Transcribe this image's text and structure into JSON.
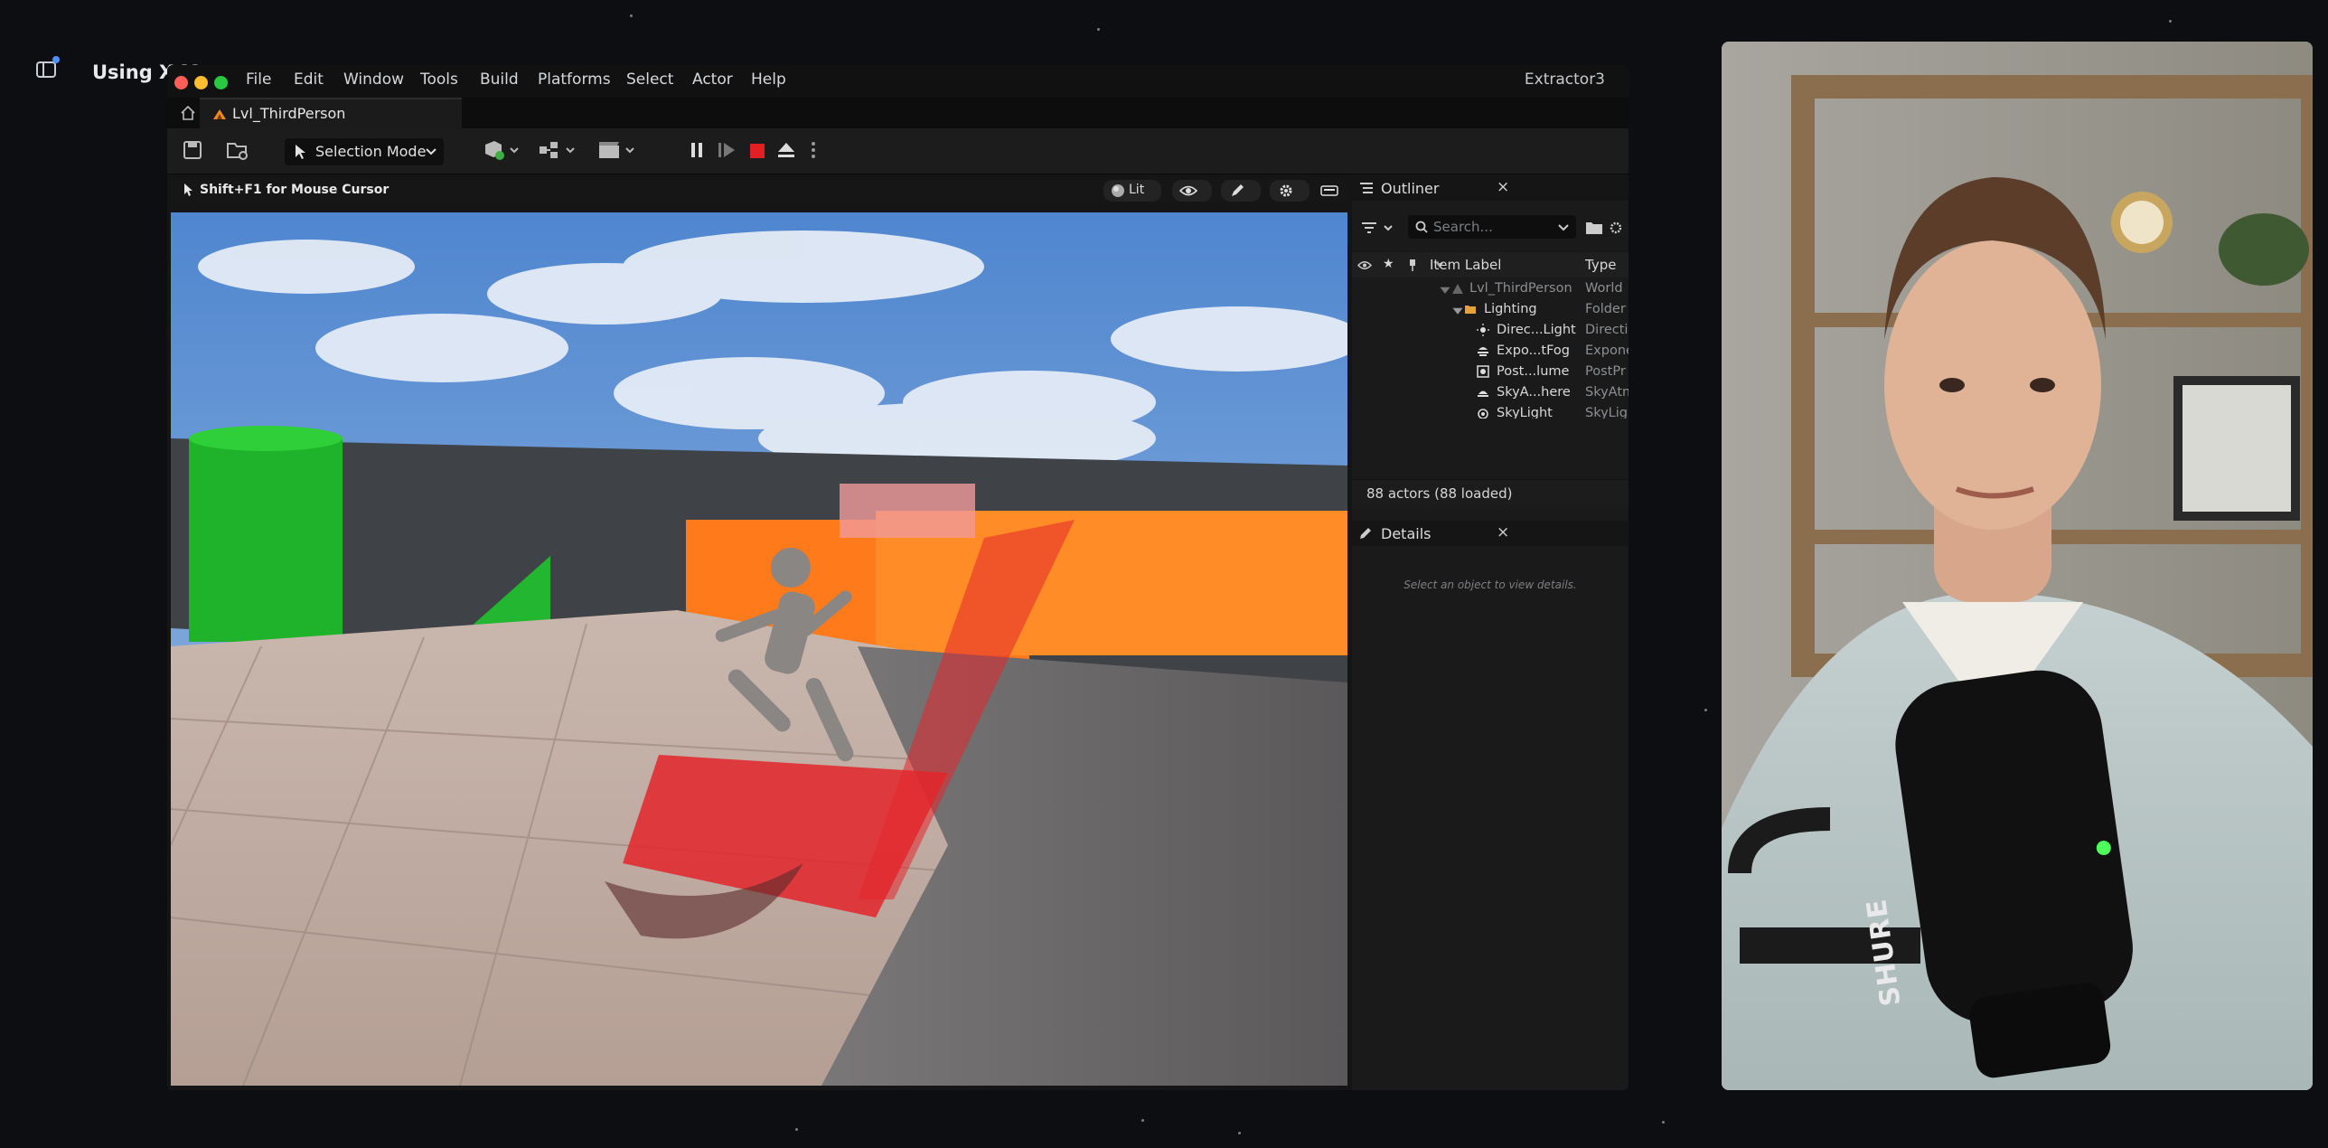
{
  "background": {
    "color": "#0d0e12"
  },
  "browser": {
    "doc_title": "Using X M"
  },
  "app": {
    "menu": [
      "File",
      "Edit",
      "Window",
      "Tools",
      "Build",
      "Platforms",
      "Select",
      "Actor",
      "Help"
    ],
    "project_name": "Extractor3",
    "tab_label": "Lvl_ThirdPerson",
    "traffic_lights": {
      "close": "#ff5f57",
      "minimize": "#febc2e",
      "maximize": "#28c840"
    }
  },
  "toolbar": {
    "selection_mode": "Selection Mode",
    "icons": [
      "save-icon",
      "content-browser-icon",
      "add-actor-icon",
      "blueprint-icon",
      "cinematics-icon",
      "pause-icon",
      "skip-frame-icon",
      "stop-icon",
      "eject-icon",
      "more-icon"
    ],
    "stop_color": "#e31f26"
  },
  "viewport": {
    "hint": "Shift+F1 for Mouse Cursor",
    "view_mode": "Lit",
    "accent_orange": "#ff7a1a",
    "accent_green": "#1fb32b",
    "accent_red": "#e3262b"
  },
  "outliner": {
    "title": "Outliner",
    "close": "×",
    "search_placeholder": "Search...",
    "columns": {
      "label": "Item Label",
      "type": "Type"
    },
    "rows": [
      {
        "label": "Lvl_ThirdPerson",
        "type": "World",
        "icon": "level-icon"
      },
      {
        "label": "Lighting",
        "type": "Folder",
        "icon": "folder-icon"
      },
      {
        "label": "Direc...Light",
        "type": "Directi",
        "icon": "directional-light-icon"
      },
      {
        "label": "Expo...tFog",
        "type": "Expone",
        "icon": "fog-icon"
      },
      {
        "label": "Post...lume",
        "type": "PostPr",
        "icon": "post-process-icon"
      },
      {
        "label": "SkyA...here",
        "type": "SkyAtm",
        "icon": "sky-atmosphere-icon"
      },
      {
        "label": "SkyLight",
        "type": "SkyLig",
        "icon": "sky-light-icon"
      }
    ],
    "actor_count": "88 actors (88 loaded)"
  },
  "details": {
    "title": "Details",
    "close": "×",
    "empty_hint": "Select an object to view details."
  },
  "webcam": {
    "mic_brand": "SHURE"
  }
}
